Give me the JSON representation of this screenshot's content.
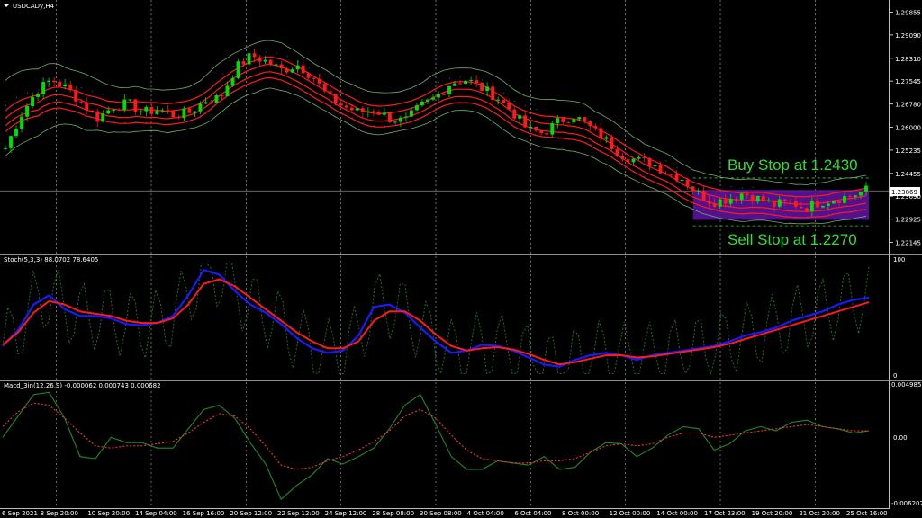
{
  "window": {
    "title": "USDCADy,H4"
  },
  "colors": {
    "background": "#000000",
    "bull": "#00e000",
    "bear": "#ff1a1a",
    "env_red": "#ff1a1a",
    "bb": "#6fae6f",
    "box": "#5a1499",
    "stoch_k": "#1a1aff",
    "stoch_d": "#ff1a1a",
    "stoch_fast": "#1f7a1f",
    "macd_main": "#1f8a1f",
    "macd_signal": "#ff3030"
  },
  "annotations": {
    "buy": "Buy Stop at 1.2430",
    "sell": "Sell Stop at 1.2270"
  },
  "chart_data": [
    {
      "type": "candlestick",
      "title": "USDCADy,H4",
      "current_price": "1.23869",
      "y_ticks": [
        "1.29855",
        "1.29090",
        "1.28310",
        "1.27545",
        "1.26780",
        "1.26000",
        "1.25235",
        "1.24455",
        "1.23690",
        "1.22925",
        "1.22145"
      ],
      "ylim": [
        1.2195,
        1.3008
      ],
      "x_ticks": [
        "6 Sep 2021",
        "8 Sep 20:00",
        "10 Sep 20:00",
        "14 Sep 04:00",
        "16 Sep 16:00",
        "20 Sep 12:00",
        "22 Sep 12:00",
        "24 Sep 12:00",
        "28 Sep 08:00",
        "30 Sep 08:00",
        "4 Oct 04:00",
        "6 Oct 04:00",
        "8 Oct 00:00",
        "12 Oct 00:00",
        "14 Oct 00:00",
        "17 Oct 23:00",
        "19 Oct 20:00",
        "21 Oct 20:00",
        "25 Oct 16:00"
      ],
      "close_path": [
        1.253,
        1.264,
        1.272,
        1.276,
        1.273,
        1.268,
        1.263,
        1.267,
        1.268,
        1.265,
        1.266,
        1.264,
        1.265,
        1.269,
        1.27,
        1.28,
        1.284,
        1.282,
        1.279,
        1.281,
        1.277,
        1.27,
        1.267,
        1.265,
        1.266,
        1.263,
        1.262,
        1.267,
        1.27,
        1.275,
        1.276,
        1.273,
        1.27,
        1.265,
        1.259,
        1.258,
        1.262,
        1.264,
        1.26,
        1.256,
        1.251,
        1.249,
        1.248,
        1.245,
        1.243,
        1.238,
        1.235,
        1.236,
        1.238,
        1.236,
        1.234,
        1.235,
        1.233,
        1.235,
        1.236,
        1.237,
        1.239
      ],
      "buy_stop": 1.243,
      "sell_stop": 1.227
    },
    {
      "type": "line",
      "title": "Stoch(5,3,3) 88.0702 78.6405",
      "y_ticks": [
        "100",
        "0"
      ],
      "ylim": [
        0,
        100
      ],
      "series": [
        {
          "values": [
            26,
            40,
            62,
            70,
            58,
            52,
            52,
            50,
            45,
            44,
            46,
            52,
            70,
            92,
            88,
            74,
            62,
            55,
            45,
            33,
            24,
            20,
            22,
            35,
            60,
            62,
            55,
            42,
            30,
            20,
            22,
            27,
            26,
            22,
            16,
            10,
            8,
            14,
            18,
            20,
            18,
            14,
            18,
            20,
            22,
            24,
            26,
            30,
            35,
            38,
            42,
            48,
            52,
            56,
            62,
            66,
            68
          ]
        },
        {
          "values": [
            27,
            38,
            55,
            65,
            62,
            56,
            54,
            52,
            48,
            46,
            46,
            50,
            62,
            80,
            84,
            78,
            68,
            58,
            48,
            38,
            30,
            24,
            24,
            30,
            48,
            56,
            56,
            48,
            36,
            26,
            22,
            24,
            25,
            23,
            19,
            14,
            10,
            12,
            15,
            18,
            18,
            16,
            17,
            19,
            21,
            23,
            25,
            28,
            32,
            36,
            40,
            44,
            48,
            52,
            56,
            60,
            64
          ]
        }
      ]
    },
    {
      "type": "line",
      "title": "Macd_3in(12,26,9) -0.000062 0.000743 0.000682",
      "y_ticks": [
        "0.004985",
        "0.00",
        "-0.006202"
      ],
      "ylim": [
        -0.006202,
        0.004985
      ],
      "series": [
        {
          "values": [
            0.0,
            0.002,
            0.004,
            0.0042,
            0.0018,
            -0.0018,
            -0.002,
            0.0,
            -0.0005,
            -0.0005,
            -0.001,
            -0.001,
            0.0008,
            0.0026,
            0.003,
            0.0018,
            -0.0005,
            -0.0025,
            -0.0058,
            -0.0045,
            -0.0035,
            -0.002,
            -0.0025,
            -0.0018,
            -0.001,
            0.0008,
            0.003,
            0.004,
            0.0012,
            -0.0018,
            -0.003,
            -0.003,
            -0.0022,
            -0.0024,
            -0.0026,
            -0.0018,
            -0.003,
            -0.0028,
            -0.0014,
            -0.0005,
            -0.0006,
            -0.0018,
            -0.001,
            0.0002,
            0.001,
            0.0008,
            -0.0012,
            -0.0006,
            0.0006,
            0.001,
            0.0006,
            0.0014,
            0.0016,
            0.001,
            0.0008,
            0.0004,
            0.0006
          ]
        },
        {
          "values": [
            0.001,
            0.0024,
            0.0032,
            0.003,
            0.0018,
            0.0004,
            -0.0008,
            -0.001,
            -0.0008,
            -0.0008,
            -0.0006,
            -0.0004,
            0.0004,
            0.0014,
            0.0022,
            0.002,
            0.0008,
            -0.0008,
            -0.0026,
            -0.003,
            -0.0028,
            -0.0022,
            -0.0018,
            -0.0012,
            -0.0004,
            0.0006,
            0.002,
            0.0026,
            0.0018,
            0.0002,
            -0.0012,
            -0.002,
            -0.0022,
            -0.0024,
            -0.0024,
            -0.0022,
            -0.0022,
            -0.002,
            -0.0014,
            -0.0008,
            -0.0006,
            -0.0008,
            -0.0006,
            0.0,
            0.0004,
            0.0004,
            0.0,
            0.0002,
            0.0004,
            0.0006,
            0.0008,
            0.001,
            0.0012,
            0.001,
            0.0008,
            0.0006,
            0.0006
          ]
        }
      ]
    }
  ]
}
